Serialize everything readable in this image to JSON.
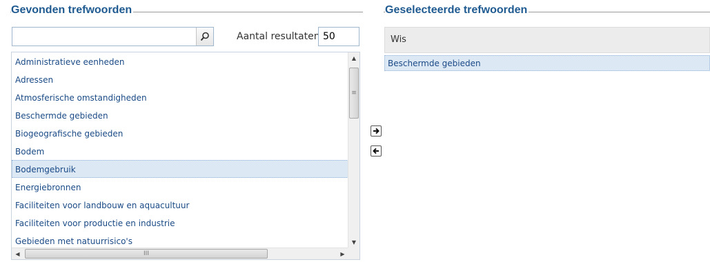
{
  "found": {
    "title": "Gevonden trefwoorden",
    "search": {
      "value": "",
      "placeholder": ""
    },
    "results_label": "Aantal resultaten",
    "results_count": "50",
    "items": [
      "Administratieve eenheden",
      "Adressen",
      "Atmosferische omstandigheden",
      "Beschermde gebieden",
      "Biogeografische gebieden",
      "Bodem",
      "Bodemgebruik",
      "Energiebronnen",
      "Faciliteiten voor landbouw en aquacultuur",
      "Faciliteiten voor productie en industrie",
      "Gebieden met natuurrisico's"
    ],
    "selected_item": "Bodemgebruik"
  },
  "selected": {
    "title": "Geselecteerde trefwoorden",
    "clear_label": "Wis",
    "items": [
      "Beschermde gebieden"
    ]
  },
  "icons": {
    "search": "search-icon",
    "add": "arrow-right-icon",
    "remove": "arrow-left-icon",
    "scroll_grip": "≡",
    "hscroll_grip": "III"
  },
  "colors": {
    "title": "#1f5a91",
    "link": "#1a4a86",
    "selection_bg": "#dde8f5"
  }
}
